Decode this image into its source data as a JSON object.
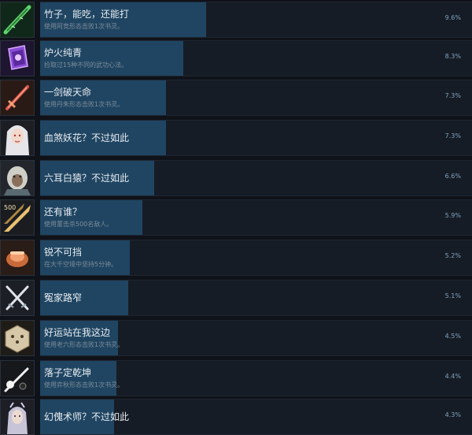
{
  "achievements": [
    {
      "name": "竹子，能吃，还能打",
      "desc": "使用阿竞形态击败1次书灵。",
      "percent": "9.6%",
      "rate": 0.096,
      "icon": "bamboo-sword-icon"
    },
    {
      "name": "炉火纯青",
      "desc": "捡取过15种不同的武功心法。",
      "percent": "8.3%",
      "rate": 0.083,
      "icon": "purple-book-icon"
    },
    {
      "name": "一剑破天命",
      "desc": "使用丹朱形态击败1次书灵。",
      "percent": "7.3%",
      "rate": 0.073,
      "icon": "red-sword-icon"
    },
    {
      "name": "血煞妖花？不过如此",
      "desc": "",
      "percent": "7.3%",
      "rate": 0.073,
      "icon": "white-haired-woman-icon"
    },
    {
      "name": "六耳白猿？不过如此",
      "desc": "",
      "percent": "6.6%",
      "rate": 0.066,
      "icon": "white-ape-icon"
    },
    {
      "name": "还有谁？",
      "desc": "使用董击杀500名敌人。",
      "percent": "5.9%",
      "rate": 0.059,
      "icon": "slash-500-icon"
    },
    {
      "name": "锐不可挡",
      "desc": "在大千空境中坚持5分钟。",
      "percent": "5.2%",
      "rate": 0.052,
      "icon": "orange-fist-icon"
    },
    {
      "name": "冤家路窄",
      "desc": "",
      "percent": "5.1%",
      "rate": 0.051,
      "icon": "crossed-swords-icon"
    },
    {
      "name": "好运站在我这边",
      "desc": "使用老六形态击败1次书灵。",
      "percent": "4.5%",
      "rate": 0.045,
      "icon": "dice-icon"
    },
    {
      "name": "落子定乾坤",
      "desc": "使用弈秋形态击败1次书灵。",
      "percent": "4.4%",
      "rate": 0.044,
      "icon": "go-stones-icon"
    },
    {
      "name": "幻傀术师？不过如此",
      "desc": "",
      "percent": "4.3%",
      "rate": 0.043,
      "icon": "puppeteer-icon"
    }
  ]
}
